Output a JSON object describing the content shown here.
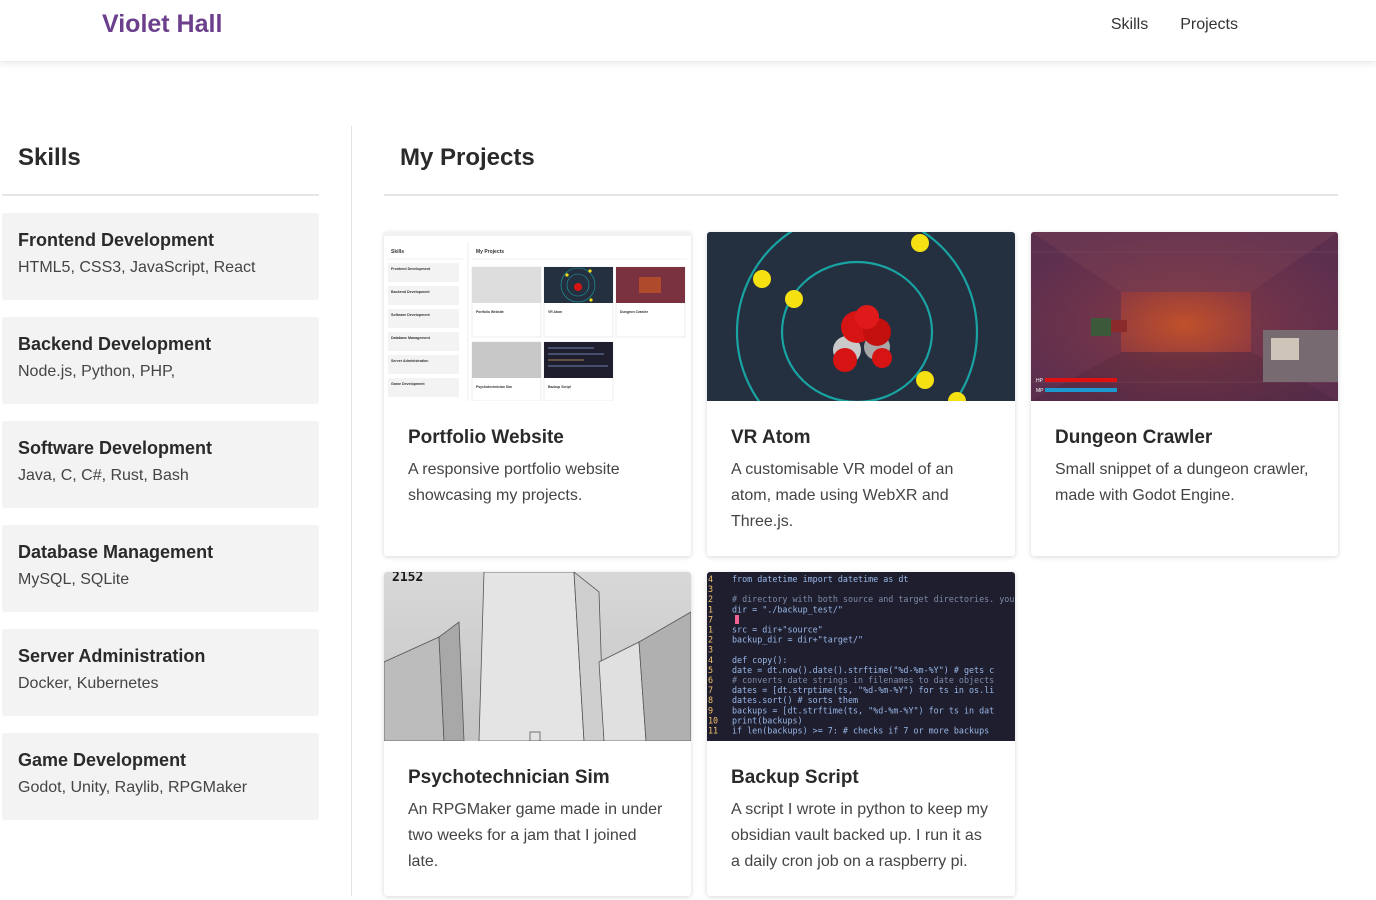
{
  "nav": {
    "brand": "Violet Hall",
    "links": [
      "Skills",
      "Projects"
    ]
  },
  "skills": {
    "title": "Skills",
    "items": [
      {
        "name": "Frontend Development",
        "list": "HTML5, CSS3, JavaScript, React"
      },
      {
        "name": "Backend Development",
        "list": "Node.js, Python, PHP,"
      },
      {
        "name": "Software Development",
        "list": "Java, C, C#, Rust, Bash"
      },
      {
        "name": "Database Management",
        "list": "MySQL, SQLite"
      },
      {
        "name": "Server Administration",
        "list": "Docker, Kubernetes"
      },
      {
        "name": "Game Development",
        "list": "Godot, Unity, Raylib, RPGMaker"
      }
    ]
  },
  "projects": {
    "title": "My Projects",
    "items": [
      {
        "title": "Portfolio Website",
        "description": "A responsive portfolio website showcasing my projects."
      },
      {
        "title": "VR Atom",
        "description": "A customisable VR model of an atom, made using WebXR and Three.js."
      },
      {
        "title": "Dungeon Crawler",
        "description": "Small snippet of a dungeon crawler, made with Godot Engine."
      },
      {
        "title": "Psychotechnician Sim",
        "description": "An RPGMaker game made in under two weeks for a jam that I joined late."
      },
      {
        "title": "Backup Script",
        "description": "A script I wrote in python to keep my obsidian vault backed up. I run it as a daily cron job on a raspberry pi."
      }
    ]
  },
  "thumbnails": {
    "portfolio": {
      "skills_heading": "Skills",
      "projects_heading": "My Projects",
      "mini_skills": [
        "Frontend Development",
        "Backend Development",
        "Software Development",
        "Database Management",
        "Server Administration",
        "Game Development"
      ],
      "mini_projects": [
        "Portfolio Website",
        "VR Atom",
        "Dungeon Crawler",
        "Psychotechnician Sim",
        "Backup Script"
      ]
    },
    "psycho_counter": "2152",
    "code_lines": [
      {
        "num": "4",
        "text": "from datetime import datetime as dt"
      },
      {
        "num": "3",
        "text": ""
      },
      {
        "num": "2",
        "text": "# directory with both source and target directories. you"
      },
      {
        "num": "1",
        "text": "dir = \"./backup_test/\""
      },
      {
        "num": "7",
        "text": ""
      },
      {
        "num": "1",
        "text": "src = dir+\"source\""
      },
      {
        "num": "2",
        "text": "backup_dir = dir+\"target/\""
      },
      {
        "num": "3",
        "text": ""
      },
      {
        "num": "4",
        "text": "def copy():"
      },
      {
        "num": "5",
        "text": "    date = dt.now().date().strftime(\"%d-%m-%Y\") # gets c"
      },
      {
        "num": "6",
        "text": "    # converts date strings in filenames to date objects"
      },
      {
        "num": "7",
        "text": "    dates = [dt.strptime(ts, \"%d-%m-%Y\") for ts in os.li"
      },
      {
        "num": "8",
        "text": "    dates.sort() # sorts them"
      },
      {
        "num": "9",
        "text": "    backups = [dt.strftime(ts, \"%d-%m-%Y\") for ts in dat"
      },
      {
        "num": "10",
        "text": "    print(backups)"
      },
      {
        "num": "11",
        "text": "    if len(backups) >= 7: # checks if 7 or more backups"
      }
    ],
    "dungeon_hud": {
      "hp": "HP",
      "mp": "MP"
    }
  },
  "colors": {
    "brand": "#6b3f8c",
    "skill_card_bg": "#f3f3f3",
    "atom_bg": "#243040",
    "electron": "#f5e012",
    "nucleus": "#d71414",
    "code_bg": "#1e1e2e"
  }
}
